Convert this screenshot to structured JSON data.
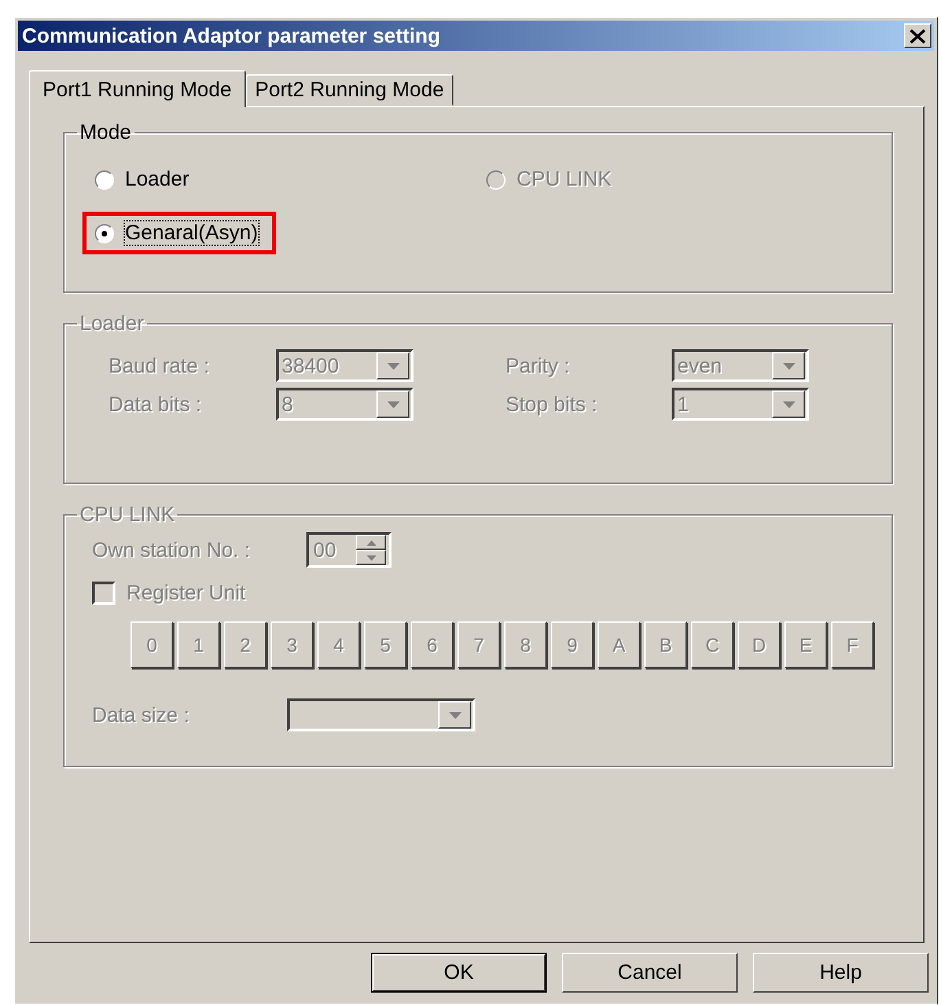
{
  "window": {
    "title": "Communication Adaptor parameter setting"
  },
  "tabs": [
    {
      "label": "Port1 Running Mode",
      "selected": true
    },
    {
      "label": "Port2 Running Mode",
      "selected": false
    }
  ],
  "mode": {
    "label": "Mode",
    "options": [
      {
        "label": "Loader",
        "selected": false,
        "disabled": false
      },
      {
        "label": "CPU LINK",
        "selected": false,
        "disabled": true
      },
      {
        "label": "Genaral(Asyn)",
        "selected": true,
        "disabled": false,
        "highlighted": true
      }
    ]
  },
  "loader": {
    "label": "Loader",
    "disabled": true,
    "fields": [
      {
        "label": "Baud rate :",
        "value": "38400"
      },
      {
        "label": "Parity :",
        "value": "even"
      },
      {
        "label": "Data bits :",
        "value": "8"
      },
      {
        "label": "Stop bits :",
        "value": "1"
      }
    ]
  },
  "cpu_link": {
    "label": "CPU LINK",
    "disabled": true,
    "own_station": {
      "label": "Own station No. :",
      "value": "00"
    },
    "register_unit": {
      "label": "Register Unit",
      "checked": false
    },
    "unit_buttons": [
      "0",
      "1",
      "2",
      "3",
      "4",
      "5",
      "6",
      "7",
      "8",
      "9",
      "A",
      "B",
      "C",
      "D",
      "E",
      "F"
    ],
    "data_size": {
      "label": "Data size :"
    }
  },
  "buttons": [
    {
      "label": "OK",
      "default": true
    },
    {
      "label": "Cancel",
      "default": false
    },
    {
      "label": "Help",
      "default": false
    }
  ]
}
